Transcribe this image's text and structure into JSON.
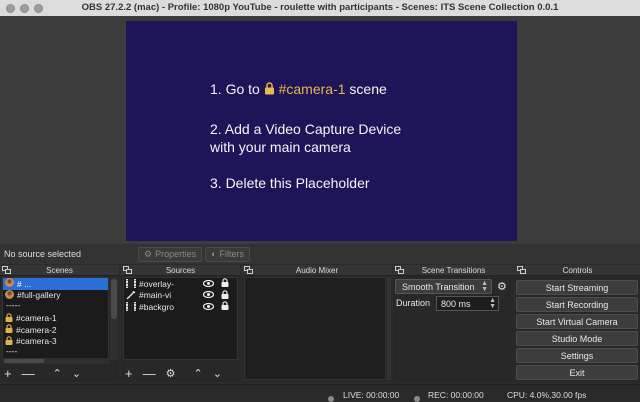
{
  "window": {
    "title": "OBS 27.2.2 (mac) - Profile: 1080p YouTube - roulette with participants - Scenes: ITS Scene Collection 0.0.1"
  },
  "preview": {
    "line1_prefix": "1. Go to",
    "line1_highlight": "#camera-1",
    "line1_suffix": "scene",
    "line2a": "2. Add a Video Capture Device",
    "line2b": "with your main camera",
    "line3": "3. Delete this Placeholder",
    "bg_color": "#1e1458",
    "highlight_color": "#e7b84a"
  },
  "toolbar": {
    "no_source": "No source selected",
    "properties_label": "Properties",
    "filters_label": "Filters"
  },
  "scenes": {
    "title": "Scenes",
    "items": [
      {
        "label": "# ...",
        "icon": "avatar-icon",
        "selected": true
      },
      {
        "label": "#full-gallery",
        "icon": "avatar-icon"
      },
      {
        "label": "-----",
        "separator": true
      },
      {
        "label": "#camera-1",
        "icon": "lock-icon"
      },
      {
        "label": "#camera-2",
        "icon": "lock-icon"
      },
      {
        "label": "#camera-3",
        "icon": "lock-icon"
      },
      {
        "label": "----",
        "separator": true
      }
    ]
  },
  "sources": {
    "title": "Sources",
    "items": [
      {
        "label": "#overlay-",
        "icon": "film-icon"
      },
      {
        "label": "#main-vi",
        "icon": "wand-icon"
      },
      {
        "label": "#backgro",
        "icon": "film-icon"
      }
    ]
  },
  "mixer": {
    "title": "Audio Mixer"
  },
  "transitions": {
    "title": "Scene Transitions",
    "selected": "Smooth Transition",
    "duration_label": "Duration",
    "duration_value": "800 ms"
  },
  "controls": {
    "title": "Controls",
    "buttons": [
      "Start Streaming",
      "Start Recording",
      "Start Virtual Camera",
      "Studio Mode",
      "Settings",
      "Exit"
    ]
  },
  "status": {
    "live": "LIVE: 00:00:00",
    "rec": "REC: 00:00:00",
    "cpu": "CPU: 4.0%,30.00 fps"
  }
}
